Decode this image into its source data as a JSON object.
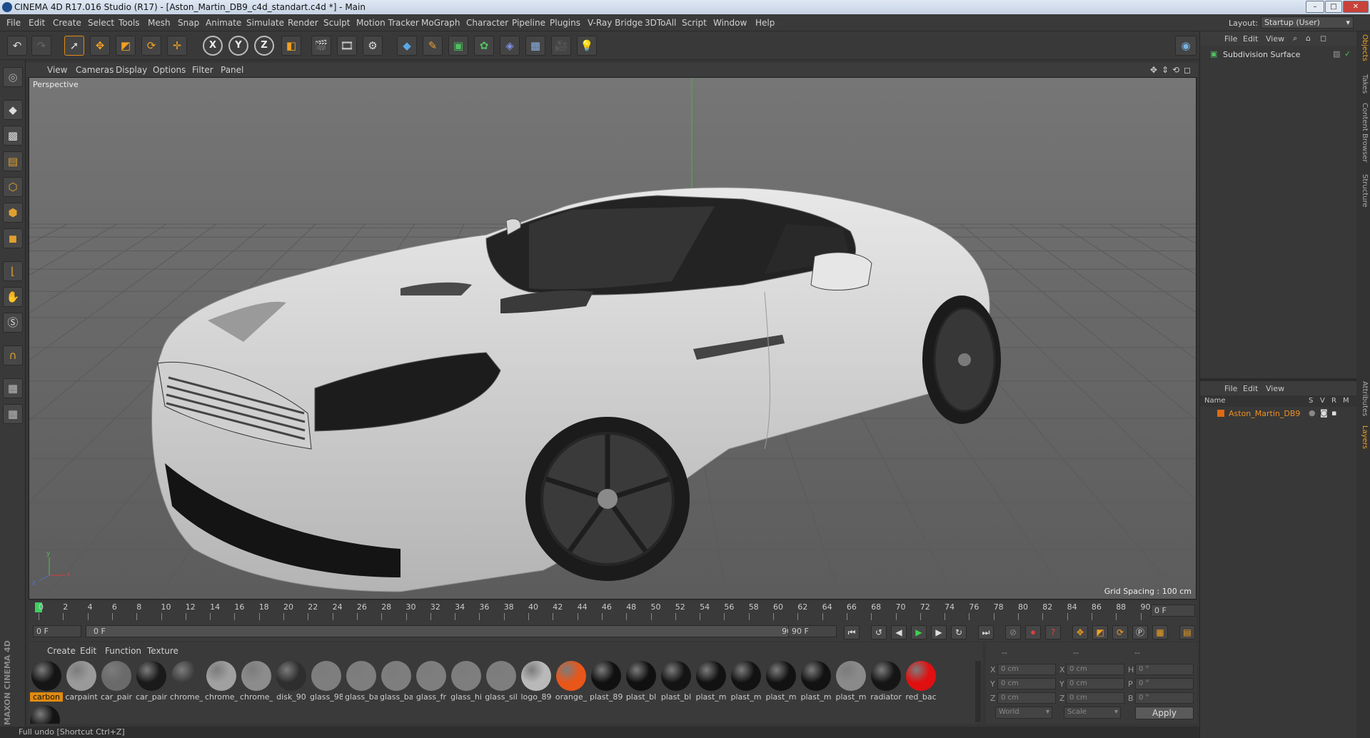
{
  "window": {
    "title": "CINEMA 4D R17.016 Studio (R17) - [Aston_Martin_DB9_c4d_standart.c4d *] - Main",
    "buttons": [
      "–",
      "□",
      "✕"
    ]
  },
  "menu": {
    "items": [
      "File",
      "Edit",
      "Create",
      "Select",
      "Tools",
      "Mesh",
      "Snap",
      "Animate",
      "Simulate",
      "Render",
      "Sculpt",
      "Motion Tracker",
      "MoGraph",
      "Character",
      "Pipeline",
      "Plugins",
      "V-Ray Bridge",
      "3DToAll",
      "Script",
      "Window",
      "Help"
    ],
    "layout_label": "Layout:",
    "layout_value": "Startup (User)"
  },
  "toolbar": {
    "axis_labels": [
      "X",
      "Y",
      "Z"
    ]
  },
  "viewport": {
    "menu": [
      "View",
      "Cameras",
      "Display",
      "Options",
      "Filter",
      "Panel"
    ],
    "camera_label": "Perspective",
    "grid_spacing": "Grid Spacing : 100 cm",
    "axis_y": "y",
    "axis_x": "x",
    "axis_z": "z"
  },
  "timeline": {
    "ticks": [
      "0",
      "2",
      "4",
      "6",
      "8",
      "10",
      "12",
      "14",
      "16",
      "18",
      "20",
      "22",
      "24",
      "26",
      "28",
      "30",
      "32",
      "34",
      "36",
      "38",
      "40",
      "42",
      "44",
      "46",
      "48",
      "50",
      "52",
      "54",
      "56",
      "58",
      "60",
      "62",
      "64",
      "66",
      "68",
      "70",
      "72",
      "74",
      "76",
      "78",
      "80",
      "82",
      "84",
      "86",
      "88",
      "90"
    ],
    "current_frame": "0 F",
    "start_frame": "0 F",
    "range_start": "0 F",
    "range_end": "90 F",
    "end_frame": "90 F"
  },
  "materials": {
    "menu": [
      "Create",
      "Edit",
      "Function",
      "Texture"
    ],
    "items": [
      {
        "label": "carbon",
        "color": "#151515"
      },
      {
        "label": "carpaint",
        "color": "#9a9a9a"
      },
      {
        "label": "car_pair",
        "color": "#6a6a6a"
      },
      {
        "label": "car_pair",
        "color": "#1a1a1a"
      },
      {
        "label": "chrome_",
        "color": "#3a3a3a"
      },
      {
        "label": "chrome_",
        "color": "#a0a0a0"
      },
      {
        "label": "chrome_",
        "color": "#8c8c8c"
      },
      {
        "label": "disk_90",
        "color": "#2e2e2e"
      },
      {
        "label": "glass_98",
        "color": "#7e7e7e"
      },
      {
        "label": "glass_ba",
        "color": "#7e7e7e"
      },
      {
        "label": "glass_ba",
        "color": "#7e7e7e"
      },
      {
        "label": "glass_fr",
        "color": "#7e7e7e"
      },
      {
        "label": "glass_hi",
        "color": "#7e7e7e"
      },
      {
        "label": "glass_sil",
        "color": "#7e7e7e"
      },
      {
        "label": "logo_89",
        "color": "#b9b9b9"
      },
      {
        "label": "orange_",
        "color": "#e8561a"
      },
      {
        "label": "plast_89",
        "color": "#101010"
      },
      {
        "label": "plast_bl",
        "color": "#101010"
      },
      {
        "label": "plast_bl",
        "color": "#141414"
      },
      {
        "label": "plast_m",
        "color": "#121212"
      },
      {
        "label": "plast_m",
        "color": "#121212"
      },
      {
        "label": "plast_m",
        "color": "#121212"
      },
      {
        "label": "plast_m",
        "color": "#121212"
      },
      {
        "label": "plast_m",
        "color": "#8a8a8a"
      },
      {
        "label": "radiator",
        "color": "#151515"
      },
      {
        "label": "red_bac",
        "color": "#e01010"
      }
    ],
    "extra_item_color": "#141414"
  },
  "coords": {
    "header": [
      "--",
      "--",
      "--"
    ],
    "rows": [
      {
        "a": "X",
        "av": "0 cm",
        "b": "X",
        "bv": "0 cm",
        "c": "H",
        "cv": "0 °"
      },
      {
        "a": "Y",
        "av": "0 cm",
        "b": "Y",
        "bv": "0 cm",
        "c": "P",
        "cv": "0 °"
      },
      {
        "a": "Z",
        "av": "0 cm",
        "b": "Z",
        "bv": "0 cm",
        "c": "B",
        "cv": "0 °"
      }
    ],
    "space": "World",
    "mode": "Scale",
    "apply": "Apply"
  },
  "objects": {
    "menu": [
      "File",
      "Edit",
      "View"
    ],
    "items": [
      {
        "name": "Subdivision Surface"
      }
    ]
  },
  "layers": {
    "menu": [
      "File",
      "Edit",
      "View"
    ],
    "columns": [
      "Name",
      "S",
      "V",
      "R",
      "M"
    ],
    "items": [
      {
        "name": "Aston_Martin_DB9"
      }
    ]
  },
  "side_tabs": [
    "Objects",
    "Takes",
    "Content Browser",
    "Structure",
    "Attributes",
    "Layers"
  ],
  "logo_text": "MAXON CINEMA 4D",
  "status": "Full undo [Shortcut Ctrl+Z]"
}
